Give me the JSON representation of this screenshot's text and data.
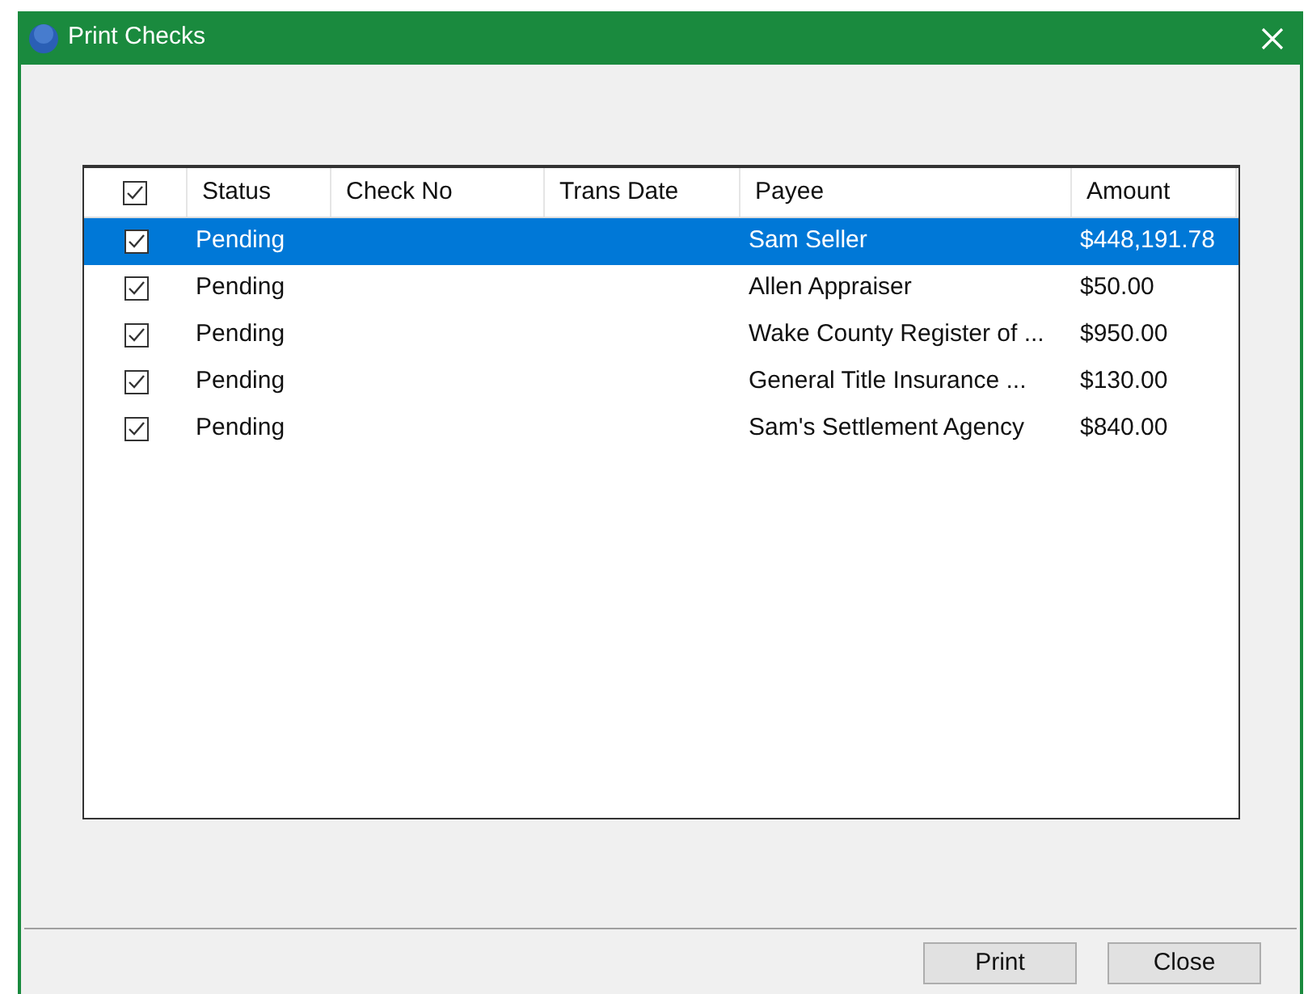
{
  "window": {
    "title": "Print Checks"
  },
  "table": {
    "select_all_checked": true,
    "columns": [
      "Status",
      "Check No",
      "Trans Date",
      "Payee",
      "Amount"
    ],
    "rows": [
      {
        "checked": true,
        "selected": true,
        "status": "Pending",
        "payee": "Sam Seller",
        "amount": "$448,191.78"
      },
      {
        "checked": true,
        "selected": false,
        "status": "Pending",
        "payee": "Allen Appraiser",
        "amount": "$50.00"
      },
      {
        "checked": true,
        "selected": false,
        "status": "Pending",
        "payee": "Wake County Register of ...",
        "amount": "$950.00"
      },
      {
        "checked": true,
        "selected": false,
        "status": "Pending",
        "payee": "General Title Insurance ...",
        "amount": "$130.00"
      },
      {
        "checked": true,
        "selected": false,
        "status": "Pending",
        "payee": "Sam's Settlement Agency",
        "amount": "$840.00"
      }
    ]
  },
  "buttons": [
    "Print",
    "Close"
  ]
}
